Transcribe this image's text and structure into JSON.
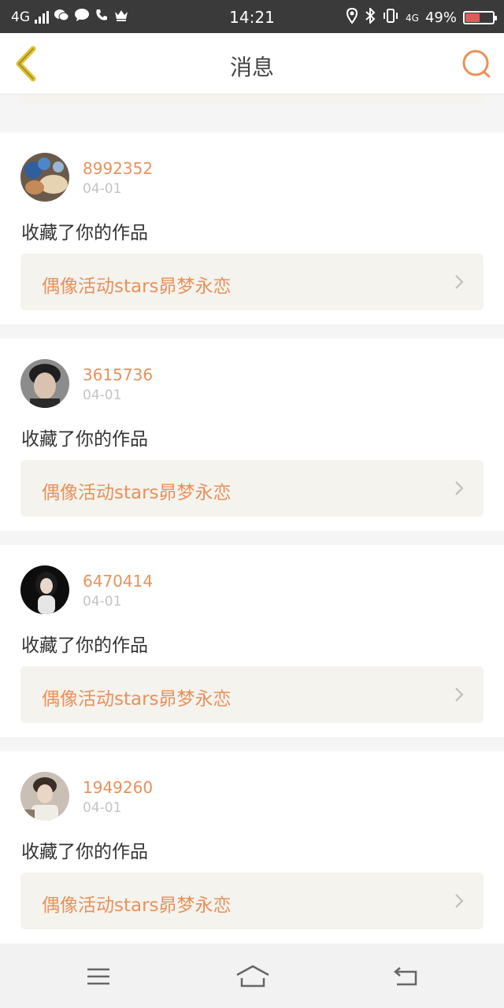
{
  "status_bar": {
    "network": "4G",
    "time": "14:21",
    "network_right": "4G",
    "battery": "49%",
    "battery_level": 0.49
  },
  "nav": {
    "title": "消息",
    "back_icon": "chevron-left-icon",
    "search_icon": "search-icon"
  },
  "colors": {
    "accent": "#e8915b",
    "nav_back": "#e0c030",
    "work_bg": "#f4f3ee"
  },
  "messages": [
    {
      "user": "8992352",
      "date": "04-01",
      "action": "收藏了你的作品",
      "work": "偶像活动stars昴梦永恋"
    },
    {
      "user": "3615736",
      "date": "04-01",
      "action": "收藏了你的作品",
      "work": "偶像活动stars昴梦永恋"
    },
    {
      "user": "6470414",
      "date": "04-01",
      "action": "收藏了你的作品",
      "work": "偶像活动stars昴梦永恋"
    },
    {
      "user": "1949260",
      "date": "04-01",
      "action": "收藏了你的作品",
      "work": "偶像活动stars昴梦永恋"
    }
  ],
  "bottom_bar": {
    "menu_icon": "menu-icon",
    "home_icon": "home-icon",
    "back_icon": "back-icon"
  }
}
